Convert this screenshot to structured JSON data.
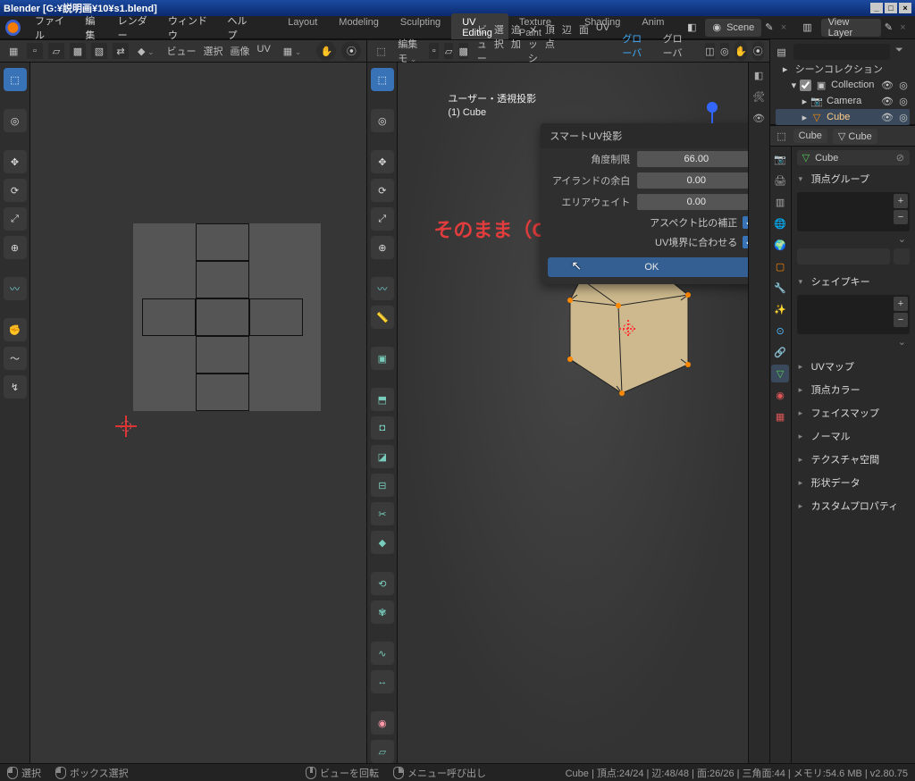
{
  "title": "Blender [G:¥説明画¥10¥s1.blend]",
  "topmenu": [
    "ファイル",
    "編集",
    "レンダー",
    "ウィンドウ",
    "ヘルプ"
  ],
  "workspaces": [
    "Layout",
    "Modeling",
    "Sculpting",
    "UV Editing",
    "Texture Paint",
    "Shading",
    "Anim"
  ],
  "active_workspace": "UV Editing",
  "scene_label": "Scene",
  "view_layer_label": "View Layer",
  "uv_header": {
    "menus": [
      "ビュー",
      "選択",
      "画像",
      "UV"
    ]
  },
  "v3d_header": {
    "mode": "編集モ",
    "menus": [
      "ビュー",
      "選択",
      "追加",
      "メッシュ",
      "頂点",
      "辺",
      "面",
      "UV"
    ],
    "orient": "グローバ"
  },
  "viewport": {
    "perspective": "ユーザー・透視投影",
    "obj": "(1) Cube"
  },
  "annotation": "そのまま（OK）",
  "popup": {
    "title": "スマートUV投影",
    "rows": [
      {
        "label": "角度制限",
        "value": "66.00"
      },
      {
        "label": "アイランドの余白",
        "value": "0.00"
      },
      {
        "label": "エリアウェイト",
        "value": "0.00"
      }
    ],
    "checks": [
      {
        "label": "アスペクト比の補正",
        "checked": true
      },
      {
        "label": "UV境界に合わせる",
        "checked": true
      }
    ],
    "ok": "OK"
  },
  "outliner": {
    "root": "シーンコレクション",
    "coll": "Collection",
    "items": [
      {
        "name": "Camera",
        "icon": "camera"
      },
      {
        "name": "Cube",
        "icon": "mesh",
        "selected": true
      }
    ]
  },
  "properties": {
    "breadcrumb": [
      "Cube",
      "Cube"
    ],
    "name": "Cube",
    "sections_open": [
      "頂点グループ",
      "シェイプキー"
    ],
    "sections_closed": [
      "UVマップ",
      "頂点カラー",
      "フェイスマップ",
      "ノーマル",
      "テクスチャ空間",
      "形状データ",
      "カスタムプロパティ"
    ]
  },
  "status": {
    "left": [
      "選択",
      "ボックス選択"
    ],
    "mid": [
      "ビューを回転"
    ],
    "mid2": [
      "メニュー呼び出し"
    ],
    "right": "Cube | 頂点:24/24 | 辺:48/48 | 面:26/26 | 三角面:44 | メモリ:54.6 MB | v2.80.75"
  }
}
